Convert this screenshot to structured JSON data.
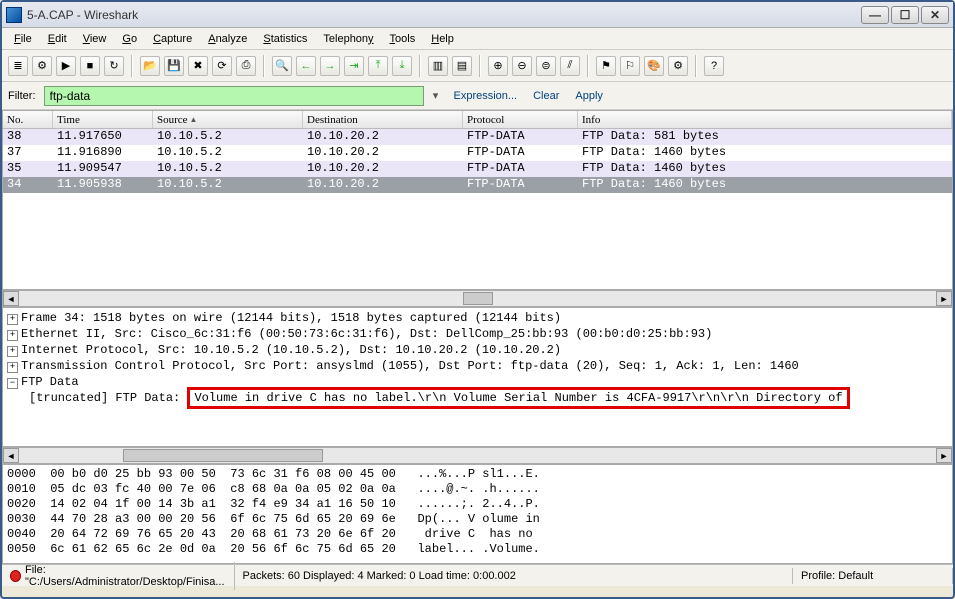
{
  "window": {
    "title": "5-A.CAP - Wireshark"
  },
  "menu": [
    "File",
    "Edit",
    "View",
    "Go",
    "Capture",
    "Analyze",
    "Statistics",
    "Telephony",
    "Tools",
    "Help"
  ],
  "filter": {
    "label": "Filter:",
    "value": "ftp-data",
    "expression": "Expression...",
    "clear": "Clear",
    "apply": "Apply"
  },
  "columns": [
    "No.",
    "Time",
    "Source",
    "Destination",
    "Protocol",
    "Info"
  ],
  "rows": [
    {
      "no": "38",
      "time": "11.917650",
      "src": "10.10.5.2",
      "dst": "10.10.20.2",
      "proto": "FTP-DATA",
      "info": "FTP Data: 581 bytes"
    },
    {
      "no": "37",
      "time": "11.916890",
      "src": "10.10.5.2",
      "dst": "10.10.20.2",
      "proto": "FTP-DATA",
      "info": "FTP Data: 1460 bytes"
    },
    {
      "no": "35",
      "time": "11.909547",
      "src": "10.10.5.2",
      "dst": "10.10.20.2",
      "proto": "FTP-DATA",
      "info": "FTP Data: 1460 bytes"
    },
    {
      "no": "34",
      "time": "11.905938",
      "src": "10.10.5.2",
      "dst": "10.10.20.2",
      "proto": "FTP-DATA",
      "info": "FTP Data: 1460 bytes"
    }
  ],
  "details": {
    "l0": "Frame 34: 1518 bytes on wire (12144 bits), 1518 bytes captured (12144 bits)",
    "l1": "Ethernet II, Src: Cisco_6c:31:f6 (00:50:73:6c:31:f6), Dst: DellComp_25:bb:93 (00:b0:d0:25:bb:93)",
    "l2": "Internet Protocol, Src: 10.10.5.2 (10.10.5.2), Dst: 10.10.20.2 (10.10.20.2)",
    "l3": "Transmission Control Protocol, Src Port: ansyslmd (1055), Dst Port: ftp-data (20), Seq: 1, Ack: 1, Len: 1460",
    "l4": "FTP Data",
    "l5": "[truncated] FTP Data:",
    "l5b": "Volume in drive C has no label.\\r\\n Volume Serial Number is 4CFA-9917\\r\\n\\r\\n Directory of"
  },
  "hex": {
    "r0": "0000  00 b0 d0 25 bb 93 00 50  73 6c 31 f6 08 00 45 00   ...%...P sl1...E.",
    "r1": "0010  05 dc 03 fc 40 00 7e 06  c8 68 0a 0a 05 02 0a 0a   ....@.~. .h......",
    "r2": "0020  14 02 04 1f 00 14 3b a1  32 f4 e9 34 a1 16 50 10   ......;. 2..4..P.",
    "r3": "0030  44 70 28 a3 00 00 20 56  6f 6c 75 6d 65 20 69 6e   Dp(... V olume in",
    "r4": "0040  20 64 72 69 76 65 20 43  20 68 61 73 20 6e 6f 20    drive C  has no ",
    "r5": "0050  6c 61 62 65 6c 2e 0d 0a  20 56 6f 6c 75 6d 65 20   label... .Volume."
  },
  "status": {
    "file": "File: \"C:/Users/Administrator/Desktop/Finisa...",
    "mid": "Packets: 60 Displayed: 4 Marked: 0 Load time: 0:00.002",
    "profile": "Profile: Default"
  }
}
